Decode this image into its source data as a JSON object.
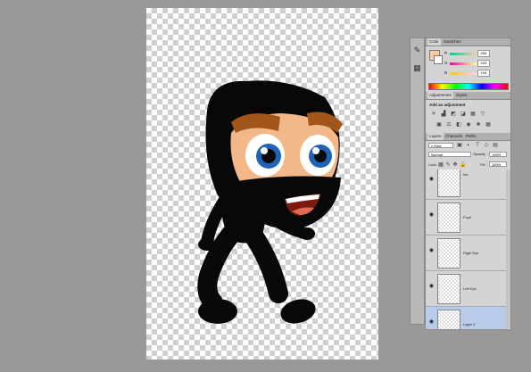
{
  "tools": [
    {
      "icon": "brush-icon",
      "glyph": "✎"
    },
    {
      "icon": "layers-icon",
      "glyph": "▦"
    }
  ],
  "color_panel": {
    "tabs": [
      "Color",
      "Swatches"
    ],
    "channels": [
      {
        "label": "R",
        "value": "254"
      },
      {
        "label": "G",
        "value": "203"
      },
      {
        "label": "B",
        "value": "154"
      }
    ],
    "foreground": "#fecb9a"
  },
  "adjustments_panel": {
    "tabs": [
      "Adjustments",
      "Styles"
    ],
    "heading": "Add an adjustment"
  },
  "layers_panel": {
    "tabs": [
      "Layers",
      "Channels",
      "Paths"
    ],
    "kind_label": "Kind",
    "blend_mode": "Normal",
    "opacity_label": "Opacity:",
    "opacity_value": "100%",
    "lock_label": "Lock:",
    "fill_label": "Fill:",
    "fill_value": "100%",
    "layers": [
      {
        "name": "Iris",
        "selected": false
      },
      {
        "name": "Pupil",
        "selected": false
      },
      {
        "name": "Right Eye",
        "selected": false
      },
      {
        "name": "Left Eye",
        "selected": false
      },
      {
        "name": "Layer 2",
        "selected": true
      }
    ]
  }
}
